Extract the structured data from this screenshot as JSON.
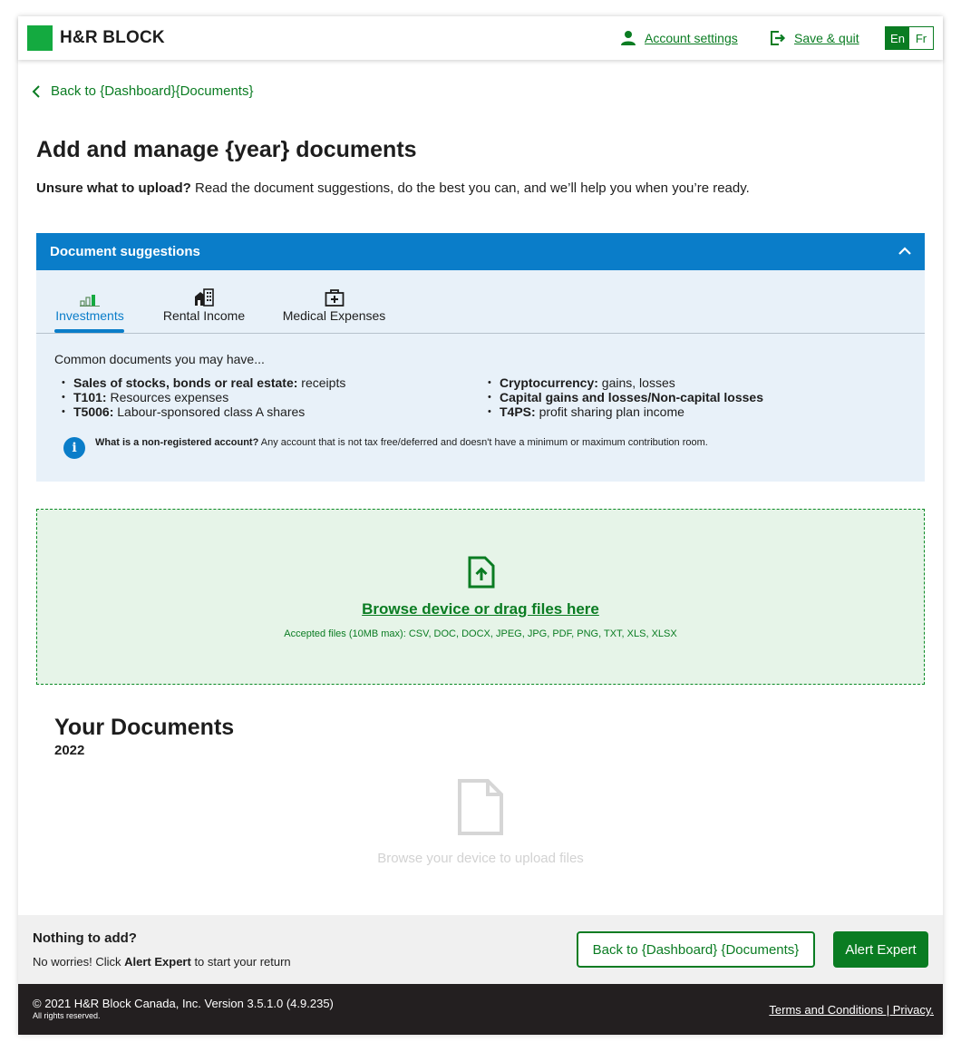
{
  "brand": {
    "name": "H&R BLOCK",
    "color": "#14aa40"
  },
  "header": {
    "account_settings": "Account settings",
    "save_quit": "Save & quit",
    "lang_en": "En",
    "lang_fr": "Fr"
  },
  "back_link": "Back to {Dashboard}{Documents}",
  "page": {
    "title": "Add and manage {year} documents",
    "subtitle_bold": "Unsure what to upload?",
    "subtitle_rest": " Read the document suggestions, do the best you can, and we’ll help you when you’re ready."
  },
  "suggestions": {
    "header": "Document suggestions",
    "tabs": [
      {
        "label": "Investments",
        "icon": "bar-chart-icon",
        "active": true
      },
      {
        "label": "Rental Income",
        "icon": "building-icon",
        "active": false
      },
      {
        "label": "Medical Expenses",
        "icon": "medical-kit-icon",
        "active": false
      }
    ],
    "intro": "Common documents you may have...",
    "left_items": [
      {
        "bold": "Sales of stocks, bonds or real estate:",
        "text": " receipts"
      },
      {
        "bold": "T101:",
        "text": " Resources expenses"
      },
      {
        "bold": "T5006:",
        "text": " Labour-sponsored class A shares"
      }
    ],
    "right_items": [
      {
        "bold": "Cryptocurrency:",
        "text": " gains, losses"
      },
      {
        "bold": "Capital gains and losses/Non-capital losses",
        "text": ""
      },
      {
        "bold": "T4PS:",
        "text": " profit sharing plan income"
      }
    ],
    "info_bold": "What is a non-registered account?",
    "info_text": " Any account that is not tax free/deferred and doesn't have a minimum or maximum contribution room."
  },
  "upload": {
    "link": "Browse device or drag files here",
    "accepted": "Accepted files (10MB max): CSV, DOC, DOCX, JPEG, JPG, PDF, PNG, TXT, XLS, XLSX"
  },
  "documents": {
    "title": "Your Documents",
    "year": "2022",
    "empty": "Browse your device to upload files"
  },
  "footer_bar": {
    "title": "Nothing to add?",
    "text_pre": "No worries! Click ",
    "text_bold": "Alert Expert",
    "text_post": " to start your return",
    "back_button": "Back to {Dashboard} {Documents}",
    "alert_button": "Alert Expert"
  },
  "copyright": {
    "main": "©  2021 H&R Block Canada, Inc. Version 3.5.1.0 (4.9.235)",
    "sub": "All rights reserved.",
    "links": "Terms and Conditions | Privacy."
  },
  "colors": {
    "green": "#0a7c22",
    "blue": "#0a7dc9",
    "panel": "#e8f1f9",
    "dropzone": "#e6f4e8"
  }
}
